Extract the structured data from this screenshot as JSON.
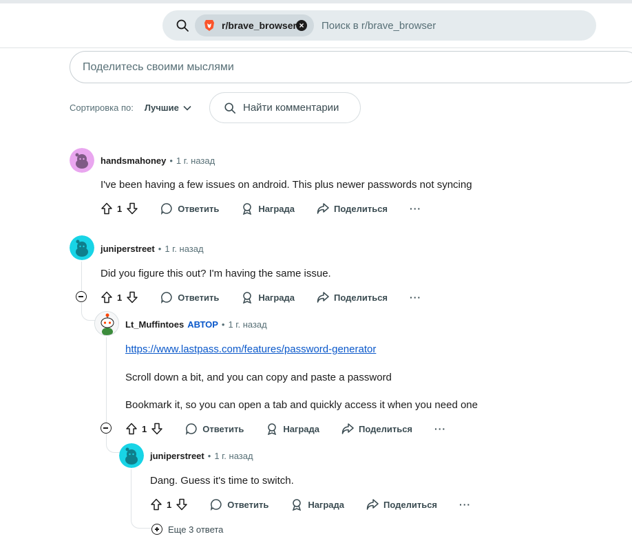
{
  "search": {
    "community_chip": "r/brave_browser",
    "placeholder": "Поиск в r/brave_browser"
  },
  "composer": {
    "placeholder": "Поделитесь своими мыслями"
  },
  "sort": {
    "label": "Сортировка по:",
    "value": "Лучшие",
    "find_comments": "Найти комментарии"
  },
  "actions": {
    "reply": "Ответить",
    "award": "Награда",
    "share": "Поделиться",
    "more": "···"
  },
  "comments": [
    {
      "author": "handsmahoney",
      "time": "1 г. назад",
      "body": "I've been having a few issues on android. This plus newer passwords not syncing",
      "score": "1",
      "avatar_color": "#e9a6ef"
    },
    {
      "author": "juniperstreet",
      "time": "1 г. назад",
      "body": "Did you figure this out? I'm having the same issue.",
      "score": "1",
      "avatar_color": "#18d4e6"
    },
    {
      "author": "Lt_Muffintoes",
      "op_badge": "АВТОР",
      "time": "1 г. назад",
      "link": "https://www.lastpass.com/features/password-generator",
      "body_line_2": "Scroll down a bit, and you can copy and paste a password",
      "body_line_3": "Bookmark it, so you can open a tab and quickly access it when you need one",
      "score": "1"
    },
    {
      "author": "juniperstreet",
      "time": "1 г. назад",
      "body": "Dang. Guess it's time to switch.",
      "score": "1",
      "avatar_color": "#18d4e6"
    }
  ],
  "more_replies": "Еще 3 ответа",
  "colors": {
    "accent_link": "#0a58ca",
    "muted_text": "#576f76",
    "search_bg": "#e5ebee"
  }
}
